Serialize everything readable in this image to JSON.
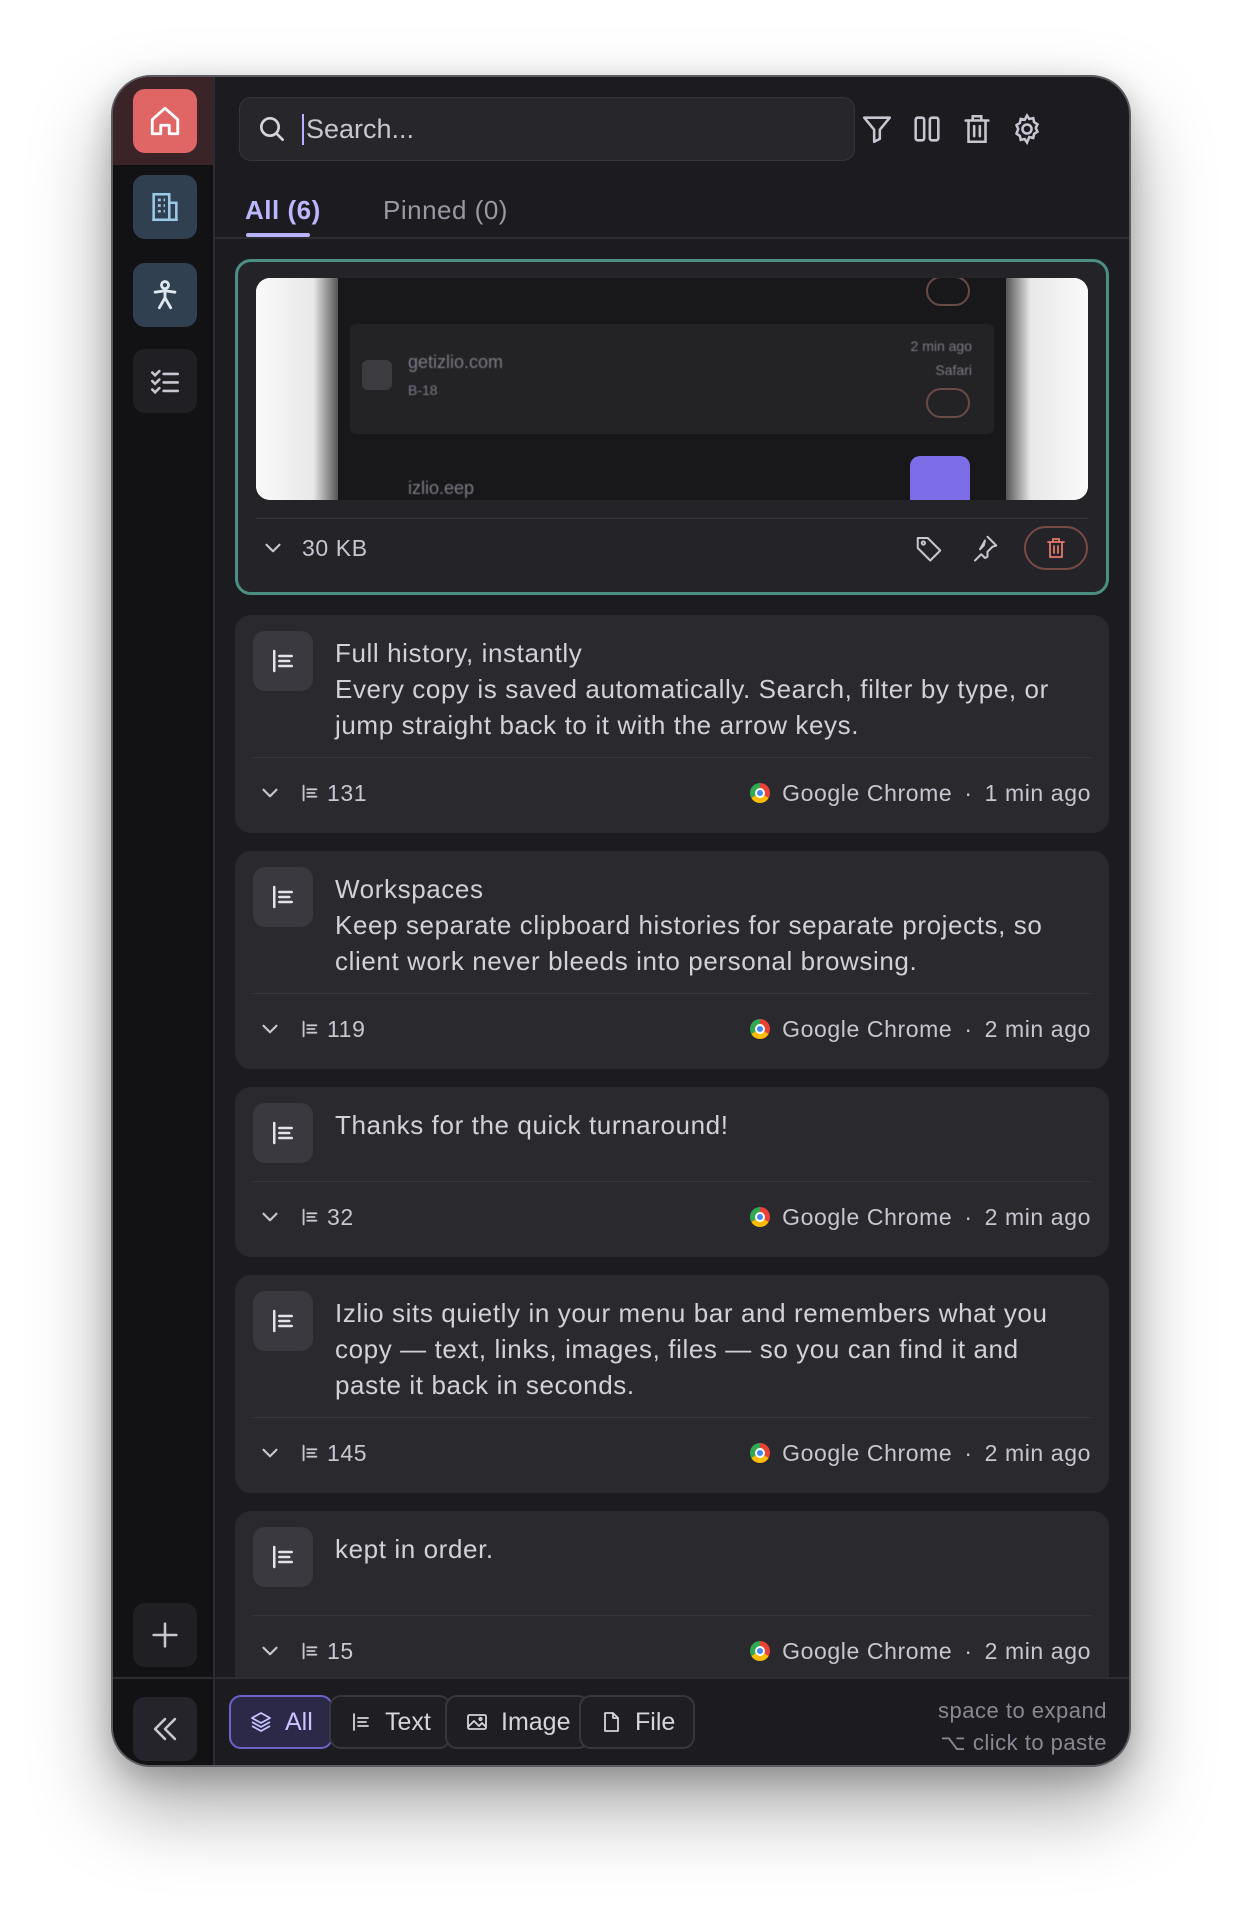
{
  "sidebar": {
    "items": [
      {
        "name": "home",
        "icon": "home-icon"
      },
      {
        "name": "workspace",
        "icon": "building-icon"
      },
      {
        "name": "person",
        "icon": "person-icon"
      },
      {
        "name": "checklist",
        "icon": "checklist-icon"
      }
    ],
    "add_icon": "plus-icon",
    "collapse_icon": "double-chevron-left-icon"
  },
  "search": {
    "placeholder": "Search...",
    "value": ""
  },
  "toolbar": {
    "icons": [
      "filter-icon",
      "columns-icon",
      "trash-icon",
      "gear-icon"
    ]
  },
  "tabs": [
    {
      "label": "All (6)",
      "active": true
    },
    {
      "label": "Pinned (0)",
      "active": false
    }
  ],
  "items": [
    {
      "type": "image",
      "size": "30 KB",
      "preview": {
        "site": "getizlio.com",
        "sub": "B-18",
        "time": "2 min ago",
        "app": "Safari",
        "other": "izlio.eep"
      }
    },
    {
      "type": "text",
      "title": "Full history, instantly",
      "body": "Every copy is saved automatically. Search, filter by type, or jump straight back to it with the arrow keys.",
      "count": "131",
      "source": "Google Chrome",
      "time": "1 min ago"
    },
    {
      "type": "text",
      "title": "Workspaces",
      "body": "Keep separate clipboard histories for separate projects, so client work never bleeds into personal browsing.",
      "count": "119",
      "source": "Google Chrome",
      "time": "2 min ago"
    },
    {
      "type": "text",
      "title": "Thanks for the quick turnaround!",
      "body": "",
      "count": "32",
      "source": "Google Chrome",
      "time": "2 min ago"
    },
    {
      "type": "text",
      "title": "",
      "body": "Izlio sits quietly in your menu bar and remembers what you copy — text, links, images, files — so you can find it and paste it back in seconds.",
      "count": "145",
      "source": "Google Chrome",
      "time": "2 min ago"
    },
    {
      "type": "text",
      "title": "kept in order.",
      "body": "",
      "count": "15",
      "source": "Google Chrome",
      "time": "2 min ago"
    }
  ],
  "separator": "·",
  "filters": [
    {
      "label": "All",
      "icon": "layers-icon",
      "active": true
    },
    {
      "label": "Text",
      "icon": "text-lines-icon",
      "active": false
    },
    {
      "label": "Image",
      "icon": "image-icon",
      "active": false
    },
    {
      "label": "File",
      "icon": "file-icon",
      "active": false
    }
  ],
  "hints": {
    "line1": "space to expand",
    "line2": "⌥ click to paste"
  },
  "colors": {
    "accent": "#b8b2ff",
    "home": "#e06565",
    "selected_border": "#4a8f82"
  }
}
